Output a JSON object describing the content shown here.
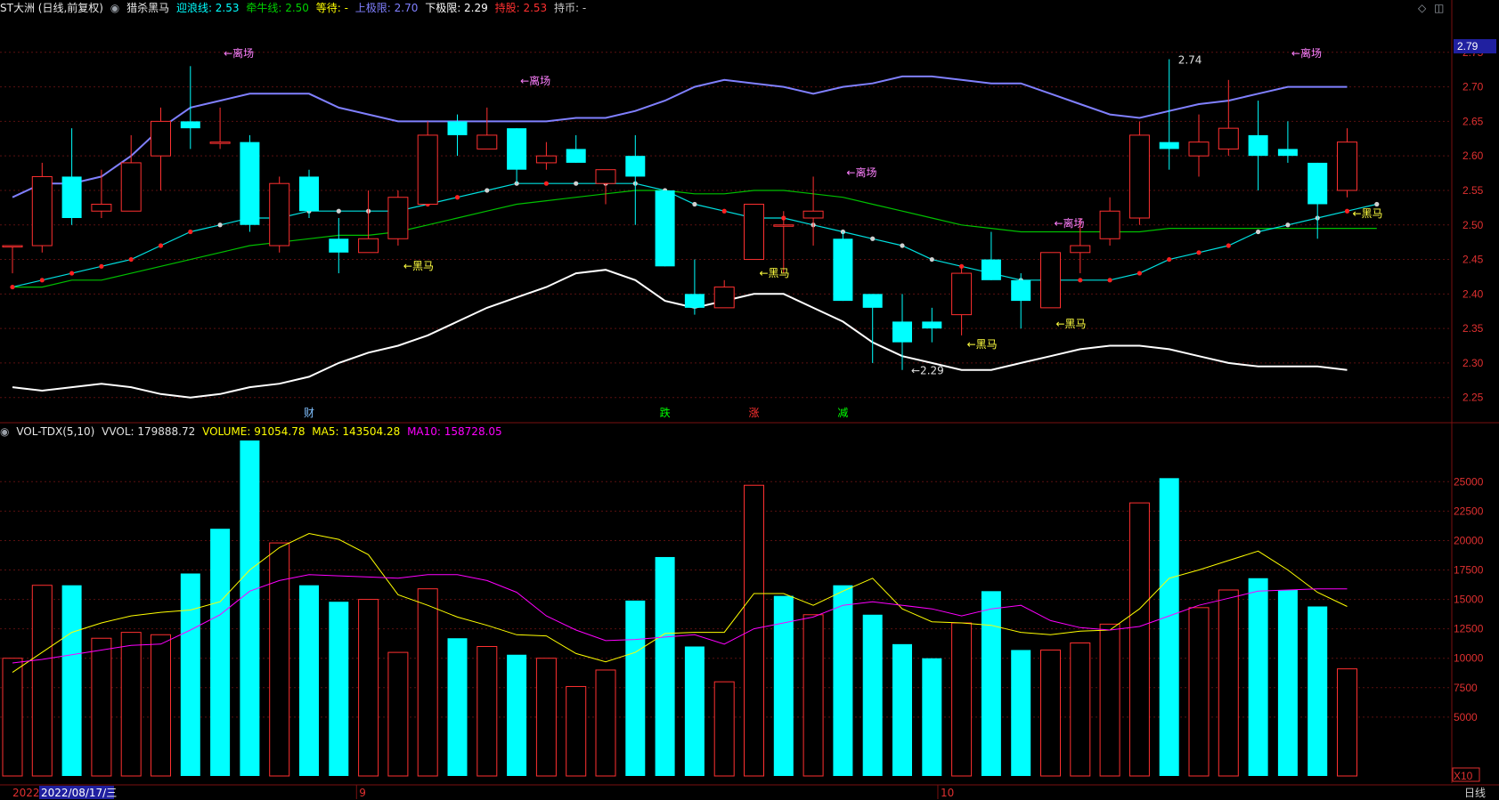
{
  "header": {
    "title": "ST大洲 (日线,前复权)",
    "indicator_name": "猎杀黑马",
    "items": [
      {
        "label": "迎浪线: 2.53",
        "color": "#00ffff"
      },
      {
        "label": "牵牛线: 2.50",
        "color": "#00d000"
      },
      {
        "label": "等待: -",
        "color": "#ffff00"
      },
      {
        "label": "上极限: 2.70",
        "color": "#8080ff"
      },
      {
        "label": "下极限: 2.29",
        "color": "#ffffff"
      },
      {
        "label": "持股: 2.53",
        "color": "#ff3030"
      },
      {
        "label": "持币: -",
        "color": "#c8c8c8"
      }
    ]
  },
  "vol_header": {
    "name": "VOL-TDX(5,10)",
    "items": [
      {
        "label": "VVOL: 179888.72",
        "color": "#e0e0e0"
      },
      {
        "label": "VOLUME: 91054.78",
        "color": "#ffff00"
      },
      {
        "label": "MA5: 143504.28",
        "color": "#ffff00"
      },
      {
        "label": "MA10: 158728.05",
        "color": "#ff00ff"
      }
    ]
  },
  "controls": {
    "diamond": "◇",
    "box": "◫"
  },
  "price_axis": {
    "ticks": [
      "2.75",
      "2.70",
      "2.65",
      "2.60",
      "2.55",
      "2.50",
      "2.45",
      "2.40",
      "2.35",
      "2.30",
      "2.25"
    ],
    "current": "2.79"
  },
  "vol_axis": {
    "ticks": [
      "25000",
      "22500",
      "20000",
      "17500",
      "15000",
      "12500",
      "10000",
      "7500",
      "5000"
    ],
    "unit": "X10"
  },
  "bottom": {
    "year": "2022",
    "date": "2022/08/17/三",
    "months": [
      "9",
      "10"
    ],
    "period": "日线"
  },
  "annotations": {
    "leave": "←离场",
    "horse": "←黑马",
    "high_label": "2.74",
    "low_label": "←2.29",
    "events": [
      "财",
      "跌",
      "涨",
      "减"
    ]
  },
  "chart_data": {
    "type": "candlestick",
    "price_ylim": [
      2.22,
      2.8
    ],
    "candles": [
      {
        "o": 2.47,
        "h": 2.47,
        "l": 2.43,
        "c": 2.47
      },
      {
        "o": 2.47,
        "h": 2.59,
        "l": 2.46,
        "c": 2.57
      },
      {
        "o": 2.57,
        "h": 2.64,
        "l": 2.5,
        "c": 2.51
      },
      {
        "o": 2.52,
        "h": 2.58,
        "l": 2.51,
        "c": 2.53
      },
      {
        "o": 2.52,
        "h": 2.63,
        "l": 2.52,
        "c": 2.59
      },
      {
        "o": 2.6,
        "h": 2.67,
        "l": 2.55,
        "c": 2.65
      },
      {
        "o": 2.65,
        "h": 2.73,
        "l": 2.61,
        "c": 2.64
      },
      {
        "o": 2.62,
        "h": 2.67,
        "l": 2.61,
        "c": 2.62
      },
      {
        "o": 2.62,
        "h": 2.63,
        "l": 2.49,
        "c": 2.5
      },
      {
        "o": 2.47,
        "h": 2.57,
        "l": 2.46,
        "c": 2.56
      },
      {
        "o": 2.57,
        "h": 2.58,
        "l": 2.51,
        "c": 2.52
      },
      {
        "o": 2.48,
        "h": 2.51,
        "l": 2.43,
        "c": 2.46
      },
      {
        "o": 2.46,
        "h": 2.55,
        "l": 2.46,
        "c": 2.48
      },
      {
        "o": 2.48,
        "h": 2.55,
        "l": 2.47,
        "c": 2.54
      },
      {
        "o": 2.53,
        "h": 2.65,
        "l": 2.53,
        "c": 2.63
      },
      {
        "o": 2.65,
        "h": 2.66,
        "l": 2.6,
        "c": 2.63
      },
      {
        "o": 2.61,
        "h": 2.67,
        "l": 2.61,
        "c": 2.63
      },
      {
        "o": 2.64,
        "h": 2.64,
        "l": 2.56,
        "c": 2.58
      },
      {
        "o": 2.59,
        "h": 2.62,
        "l": 2.58,
        "c": 2.6
      },
      {
        "o": 2.61,
        "h": 2.63,
        "l": 2.59,
        "c": 2.59
      },
      {
        "o": 2.56,
        "h": 2.58,
        "l": 2.53,
        "c": 2.58
      },
      {
        "o": 2.6,
        "h": 2.63,
        "l": 2.5,
        "c": 2.57
      },
      {
        "o": 2.55,
        "h": 2.55,
        "l": 2.44,
        "c": 2.44
      },
      {
        "o": 2.4,
        "h": 2.45,
        "l": 2.37,
        "c": 2.38
      },
      {
        "o": 2.38,
        "h": 2.42,
        "l": 2.38,
        "c": 2.41
      },
      {
        "o": 2.45,
        "h": 2.53,
        "l": 2.45,
        "c": 2.53
      },
      {
        "o": 2.5,
        "h": 2.52,
        "l": 2.43,
        "c": 2.5
      },
      {
        "o": 2.51,
        "h": 2.57,
        "l": 2.47,
        "c": 2.52
      },
      {
        "o": 2.48,
        "h": 2.49,
        "l": 2.39,
        "c": 2.39
      },
      {
        "o": 2.4,
        "h": 2.4,
        "l": 2.3,
        "c": 2.38
      },
      {
        "o": 2.36,
        "h": 2.4,
        "l": 2.29,
        "c": 2.33
      },
      {
        "o": 2.36,
        "h": 2.38,
        "l": 2.33,
        "c": 2.35
      },
      {
        "o": 2.37,
        "h": 2.44,
        "l": 2.34,
        "c": 2.43
      },
      {
        "o": 2.45,
        "h": 2.49,
        "l": 2.42,
        "c": 2.42
      },
      {
        "o": 2.42,
        "h": 2.43,
        "l": 2.35,
        "c": 2.39
      },
      {
        "o": 2.38,
        "h": 2.46,
        "l": 2.38,
        "c": 2.46
      },
      {
        "o": 2.46,
        "h": 2.51,
        "l": 2.43,
        "c": 2.47
      },
      {
        "o": 2.48,
        "h": 2.54,
        "l": 2.47,
        "c": 2.52
      },
      {
        "o": 2.51,
        "h": 2.65,
        "l": 2.5,
        "c": 2.63
      },
      {
        "o": 2.62,
        "h": 2.74,
        "l": 2.58,
        "c": 2.61
      },
      {
        "o": 2.6,
        "h": 2.66,
        "l": 2.57,
        "c": 2.62
      },
      {
        "o": 2.61,
        "h": 2.71,
        "l": 2.6,
        "c": 2.64
      },
      {
        "o": 2.63,
        "h": 2.68,
        "l": 2.55,
        "c": 2.6
      },
      {
        "o": 2.61,
        "h": 2.65,
        "l": 2.59,
        "c": 2.6
      },
      {
        "o": 2.59,
        "h": 2.59,
        "l": 2.48,
        "c": 2.53
      },
      {
        "o": 2.55,
        "h": 2.64,
        "l": 2.54,
        "c": 2.62
      }
    ],
    "upper_band": [
      2.54,
      2.56,
      2.56,
      2.57,
      2.6,
      2.64,
      2.67,
      2.68,
      2.69,
      2.69,
      2.69,
      2.67,
      2.66,
      2.65,
      2.65,
      2.65,
      2.65,
      2.65,
      2.65,
      2.655,
      2.655,
      2.665,
      2.68,
      2.7,
      2.71,
      2.705,
      2.7,
      2.69,
      2.7,
      2.705,
      2.715,
      2.715,
      2.71,
      2.705,
      2.705,
      2.69,
      2.675,
      2.66,
      2.655,
      2.665,
      2.675,
      2.68,
      2.69,
      2.7,
      2.7,
      2.7,
      2.695,
      2.7
    ],
    "lower_band": [
      2.265,
      2.26,
      2.265,
      2.27,
      2.265,
      2.255,
      2.25,
      2.255,
      2.265,
      2.27,
      2.28,
      2.3,
      2.315,
      2.325,
      2.34,
      2.36,
      2.38,
      2.395,
      2.41,
      2.43,
      2.435,
      2.42,
      2.39,
      2.38,
      2.39,
      2.4,
      2.4,
      2.38,
      2.36,
      2.33,
      2.31,
      2.3,
      2.29,
      2.29,
      2.3,
      2.31,
      2.32,
      2.325,
      2.325,
      2.32,
      2.31,
      2.3,
      2.295,
      2.295,
      2.295,
      2.29
    ],
    "mid_line": [
      2.41,
      2.42,
      2.43,
      2.44,
      2.45,
      2.47,
      2.49,
      2.5,
      2.51,
      2.51,
      2.52,
      2.52,
      2.52,
      2.52,
      2.53,
      2.54,
      2.55,
      2.56,
      2.56,
      2.56,
      2.56,
      2.56,
      2.55,
      2.53,
      2.52,
      2.51,
      2.51,
      2.5,
      2.49,
      2.48,
      2.47,
      2.45,
      2.44,
      2.43,
      2.42,
      2.42,
      2.42,
      2.42,
      2.43,
      2.45,
      2.46,
      2.47,
      2.49,
      2.5,
      2.51,
      2.52,
      2.53
    ],
    "mid_dots": [
      "r",
      "r",
      "r",
      "r",
      "r",
      "r",
      "r",
      "w",
      "w",
      "w",
      "w",
      "w",
      "w",
      "r",
      "r",
      "r",
      "w",
      "w",
      "r",
      "w",
      "w",
      "w",
      "w",
      "w",
      "r",
      "r",
      "r",
      "w",
      "w",
      "w",
      "w",
      "w",
      "r",
      "r",
      "w",
      "r",
      "r",
      "r",
      "r",
      "r",
      "r",
      "r",
      "w",
      "w",
      "w",
      "r"
    ],
    "slow_line": [
      2.41,
      2.41,
      2.42,
      2.42,
      2.43,
      2.44,
      2.45,
      2.46,
      2.47,
      2.475,
      2.48,
      2.485,
      2.485,
      2.49,
      2.5,
      2.51,
      2.52,
      2.53,
      2.535,
      2.54,
      2.545,
      2.55,
      2.55,
      2.545,
      2.545,
      2.55,
      2.55,
      2.545,
      2.54,
      2.53,
      2.52,
      2.51,
      2.5,
      2.495,
      2.49,
      2.49,
      2.49,
      2.49,
      2.49,
      2.495,
      2.495,
      2.495,
      2.495,
      2.495,
      2.495,
      2.495,
      2.495
    ],
    "volume_ylim": [
      0,
      28500
    ],
    "volume": [
      10000,
      16200,
      16200,
      11700,
      12200,
      12000,
      17200,
      21000,
      28500,
      19800,
      16200,
      14800,
      15000,
      10500,
      15900,
      11700,
      11000,
      10300,
      10000,
      7600,
      9000,
      14900,
      18600,
      11000,
      8000,
      24700,
      15300,
      13700,
      16200,
      13700,
      11200,
      10000,
      13000,
      15700,
      10700,
      10700,
      11300,
      12900,
      23200,
      25300,
      14300,
      15800,
      16800,
      15800,
      14400,
      9100
    ],
    "volume_up": [
      true,
      true,
      false,
      true,
      true,
      true,
      false,
      false,
      false,
      true,
      false,
      false,
      true,
      true,
      true,
      false,
      true,
      false,
      true,
      true,
      true,
      false,
      false,
      false,
      true,
      true,
      false,
      true,
      false,
      false,
      false,
      false,
      true,
      false,
      false,
      true,
      true,
      true,
      true,
      false,
      true,
      true,
      false,
      false,
      false,
      true
    ],
    "vol_ma5": [
      8800,
      10500,
      12200,
      13000,
      13600,
      13900,
      14100,
      14800,
      17500,
      19400,
      20600,
      20100,
      18800,
      15400,
      14500,
      13500,
      12800,
      12000,
      11900,
      10400,
      9700,
      10500,
      12100,
      12200,
      12200,
      15500,
      15500,
      14500,
      15700,
      16800,
      14200,
      13100,
      13000,
      12800,
      12200,
      12000,
      12300,
      12400,
      14200,
      16800,
      17500,
      18300,
      19100,
      17500,
      15600,
      14400
    ],
    "vol_ma10": [
      9600,
      9900,
      10300,
      10700,
      11100,
      11200,
      12400,
      13700,
      15700,
      16600,
      17100,
      17000,
      16900,
      16800,
      17100,
      17100,
      16600,
      15600,
      13600,
      12400,
      11500,
      11600,
      11800,
      12000,
      11200,
      12500,
      13000,
      13500,
      14500,
      14800,
      14500,
      14200,
      13600,
      14200,
      14500,
      13200,
      12600,
      12400,
      12700,
      13600,
      14500,
      15100,
      15700,
      15800,
      15900,
      15900
    ]
  },
  "chart_labels": {
    "leave_marks": [
      7,
      17,
      28,
      35,
      43
    ],
    "horse_marks": [
      13,
      25,
      32,
      35,
      45
    ],
    "event_positions": [
      10,
      22,
      25,
      28
    ]
  }
}
